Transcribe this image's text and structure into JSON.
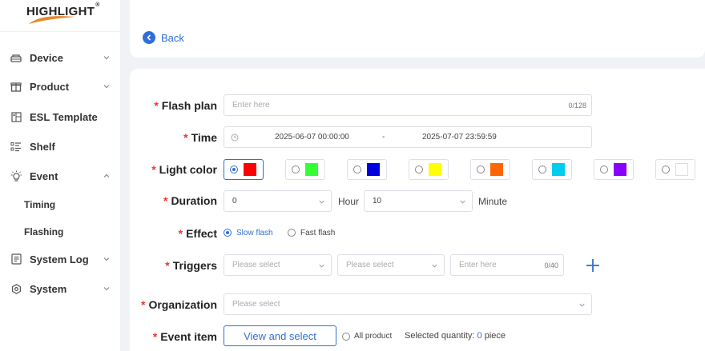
{
  "brand": {
    "logo_text": "HIGHLIGHT",
    "registered": "®"
  },
  "sidebar": {
    "items": [
      {
        "label": "Device",
        "icon": "device-icon",
        "chevron": "down"
      },
      {
        "label": "Product",
        "icon": "gift-icon",
        "chevron": "down"
      },
      {
        "label": "ESL Template",
        "icon": "template-icon"
      },
      {
        "label": "Shelf",
        "icon": "shelf-list-icon"
      },
      {
        "label": "Event",
        "icon": "sun-bulb-icon",
        "chevron": "up"
      },
      {
        "label": "System Log",
        "icon": "log-icon",
        "chevron": "down"
      },
      {
        "label": "System",
        "icon": "gear-icon",
        "chevron": "down"
      }
    ],
    "event_sub": [
      "Timing",
      "Flashing"
    ]
  },
  "header": {
    "back_label": "Back"
  },
  "form": {
    "flash_plan": {
      "label": "Flash plan",
      "placeholder": "Enter here",
      "count": "0/128"
    },
    "time": {
      "label": "Time",
      "start": "2025-06-07 00:00:00",
      "separator": "-",
      "end": "2025-07-07 23:59:59"
    },
    "light_color": {
      "label": "Light color",
      "options": [
        "#ff0000",
        "#33ff33",
        "#0000e0",
        "#ffff00",
        "#ff6600",
        "#00ccee",
        "#8800ff",
        "#ffffff"
      ],
      "selected_index": 0
    },
    "duration": {
      "label": "Duration",
      "hours": "0",
      "hour_unit": "Hour",
      "minutes": "10",
      "minute_unit": "Minute"
    },
    "effect": {
      "label": "Effect",
      "options": [
        "Slow flash",
        "Fast flash"
      ],
      "selected_index": 0
    },
    "triggers": {
      "label": "Triggers",
      "select1_placeholder": "Please select",
      "select2_placeholder": "Please select",
      "input_placeholder": "Enter here",
      "count": "0/40"
    },
    "organization": {
      "label": "Organization",
      "placeholder": "Please select"
    },
    "event_item": {
      "label": "Event item",
      "button": "View and select",
      "all_product": "All product",
      "selected_prefix": "Selected quantity:",
      "selected_count": "0",
      "selected_suffix": "piece"
    }
  },
  "required_mark": "*"
}
